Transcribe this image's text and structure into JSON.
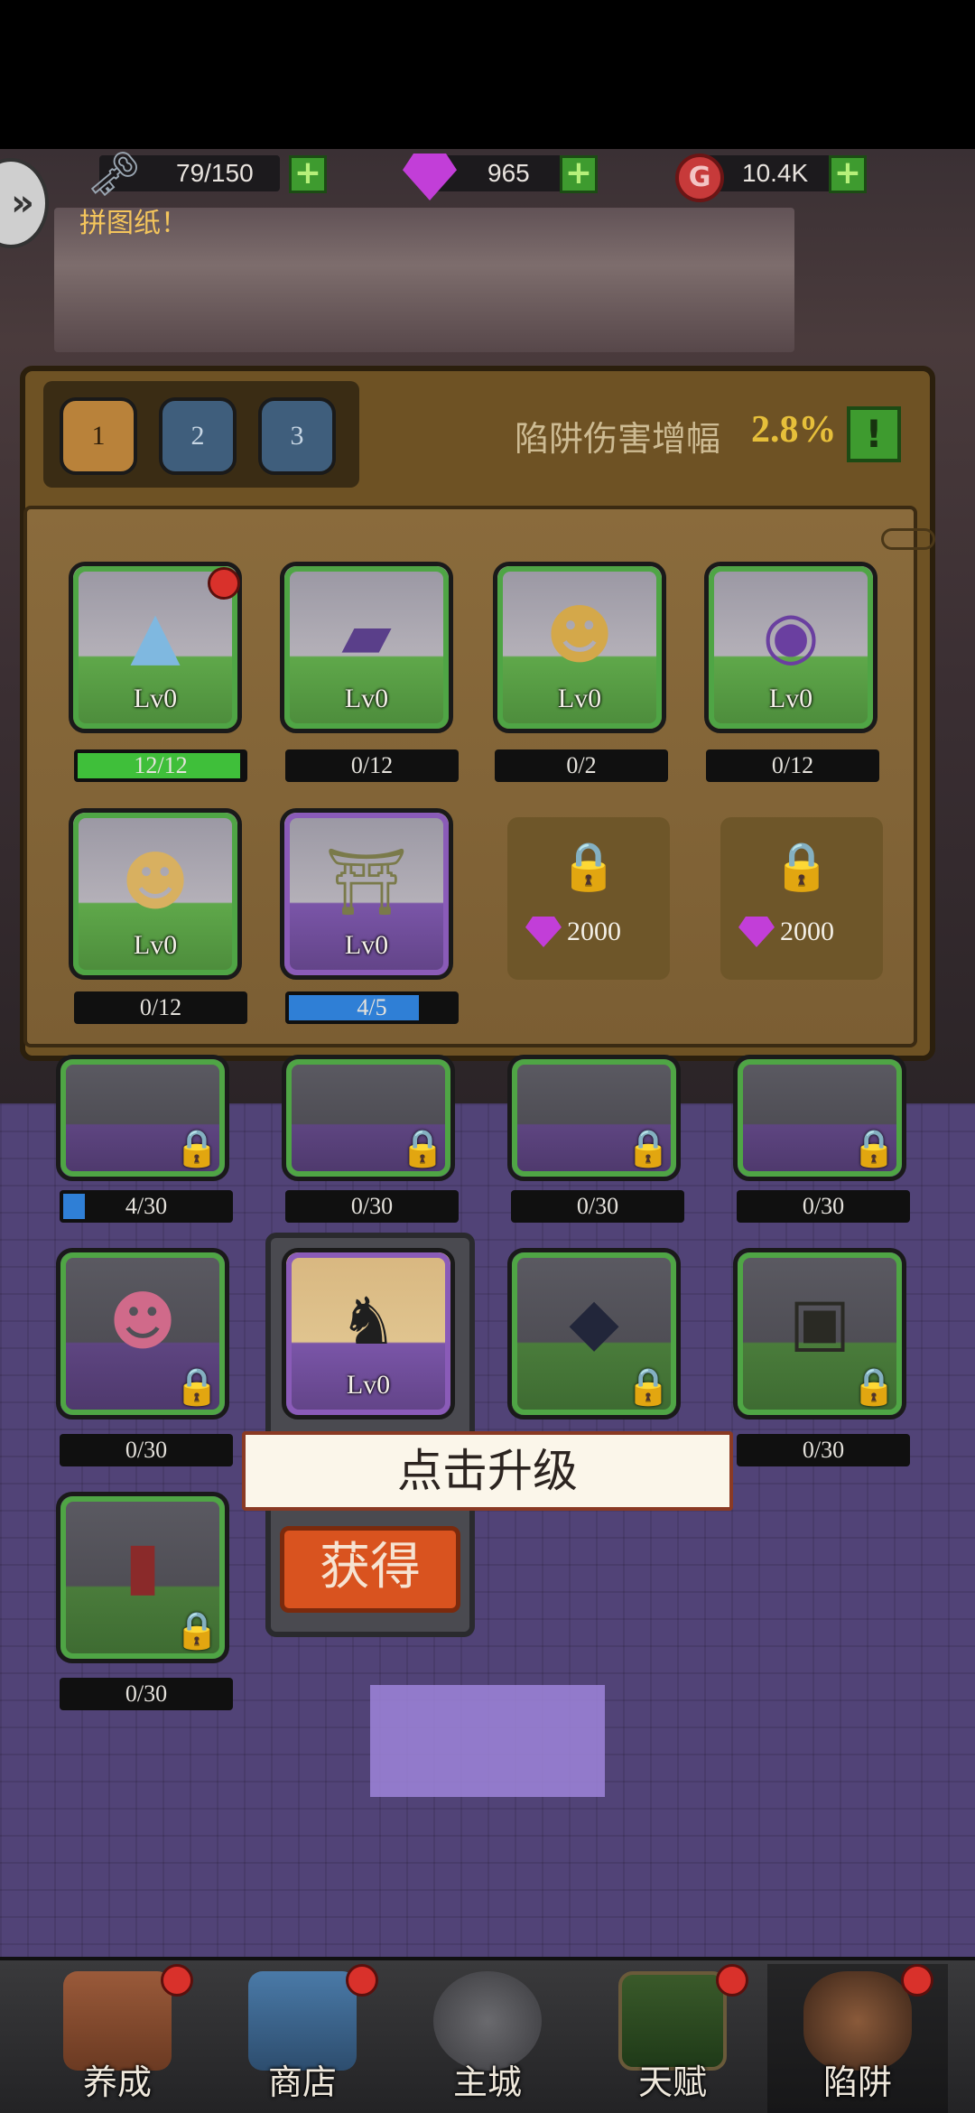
{
  "resources": {
    "keys": "79/150",
    "gems": "965",
    "gold": "10.4K"
  },
  "notice": "拼图纸！",
  "tabs": [
    "1",
    "2",
    "3"
  ],
  "bonus": {
    "label": "陷阱伤害增幅",
    "value": "2.8%",
    "info": "!"
  },
  "traps_row1": [
    {
      "level": "Lv0",
      "progress": "12/12",
      "fill_ratio": 1.0
    },
    {
      "level": "Lv0",
      "progress": "0/12",
      "fill_ratio": 0
    },
    {
      "level": "Lv0",
      "progress": "0/2",
      "fill_ratio": 0
    },
    {
      "level": "Lv0",
      "progress": "0/12",
      "fill_ratio": 0
    }
  ],
  "traps_row2": [
    {
      "level": "Lv0",
      "progress": "0/12",
      "fill_ratio": 0
    },
    {
      "level": "Lv0",
      "progress": "4/5",
      "fill_ratio": 0.8
    }
  ],
  "locked_slots": [
    {
      "price": "2000"
    },
    {
      "price": "2000"
    }
  ],
  "collection_row1": [
    {
      "progress": "4/30",
      "fill_ratio": 0.133
    },
    {
      "progress": "0/30",
      "fill_ratio": 0
    },
    {
      "progress": "0/30",
      "fill_ratio": 0
    },
    {
      "progress": "0/30",
      "fill_ratio": 0
    }
  ],
  "collection_row2": [
    {
      "progress": "0/30"
    },
    {
      "level": "Lv0"
    },
    {
      "progress": ""
    },
    {
      "progress": "0/30"
    }
  ],
  "collection_row3": [
    {
      "progress": "0/30"
    }
  ],
  "tooltip": "点击升级",
  "get_button": "获得",
  "nav": [
    {
      "label": "养成",
      "icon": "character-icon"
    },
    {
      "label": "商店",
      "icon": "shop-icon"
    },
    {
      "label": "主城",
      "icon": "castle-icon"
    },
    {
      "label": "天赋",
      "icon": "talent-icon"
    },
    {
      "label": "陷阱",
      "icon": "trap-icon"
    }
  ],
  "colors": {
    "green_fill": "#3fbf3a",
    "blue_fill": "#2f7fd6",
    "accent_orange": "#d9531f",
    "gem_purple": "#c23ed8"
  }
}
